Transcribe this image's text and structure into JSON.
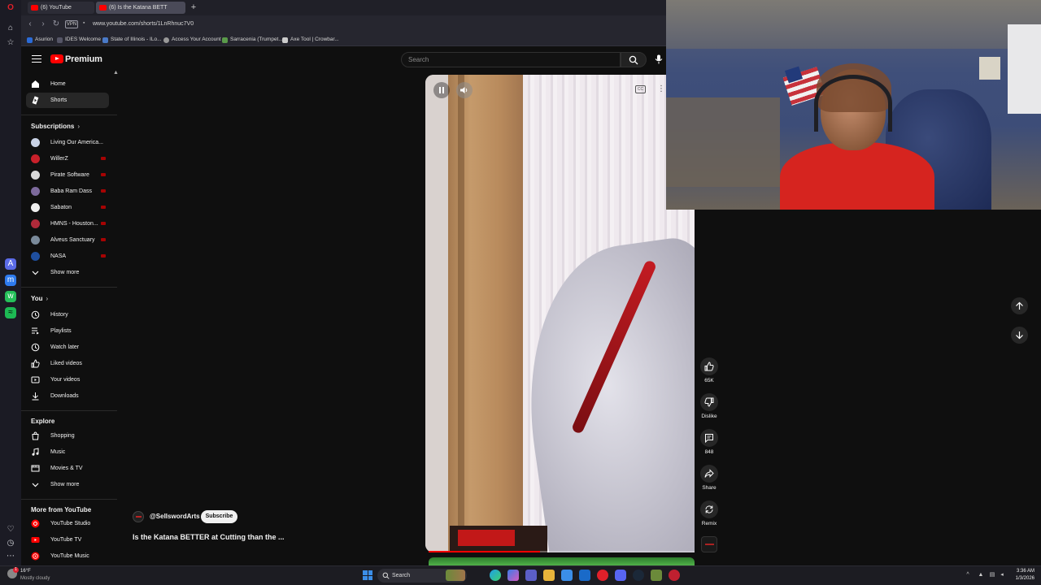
{
  "browser": {
    "tabs": [
      {
        "label": "(6) YouTube",
        "active": false
      },
      {
        "label": "(6) Is the Katana BETT",
        "active": true
      }
    ],
    "vpn_label": "VPN",
    "url": "www.youtube.com/shorts/1LnRhnuc7V0",
    "bookmarks": [
      "Asurion",
      "IDES Welcome",
      "State of Illinois - ILo...",
      "Access Your Account",
      "Sarracenia (Trumpet...",
      "Axe Tool | Crowbar..."
    ]
  },
  "masthead": {
    "brand": "Premium",
    "search_placeholder": "Search"
  },
  "guide": {
    "main": [
      {
        "label": "Home",
        "icon": "home-icon",
        "active": false
      },
      {
        "label": "Shorts",
        "icon": "shorts-icon",
        "active": true
      }
    ],
    "subscriptions_title": "Subscriptions",
    "subscriptions": [
      {
        "label": "Living Our America...",
        "color": "#c9d3e6",
        "live": false
      },
      {
        "label": "WillerZ",
        "color": "#c8202a",
        "live": true
      },
      {
        "label": "Pirate Software",
        "color": "#d9d9d9",
        "live": true
      },
      {
        "label": "Baba Ram Dass",
        "color": "#7d6a9c",
        "live": true
      },
      {
        "label": "Sabaton",
        "color": "#f0f0f0",
        "live": true
      },
      {
        "label": "HMNS - Houston...",
        "color": "#b02a3a",
        "live": true
      },
      {
        "label": "Alveus Sanctuary",
        "color": "#7a8a9a",
        "live": true
      },
      {
        "label": "NASA",
        "color": "#1f4f9e",
        "live": true
      }
    ],
    "subscriptions_more": "Show more",
    "you_title": "You",
    "you_items": [
      {
        "label": "History",
        "icon": "history-icon"
      },
      {
        "label": "Playlists",
        "icon": "playlists-icon"
      },
      {
        "label": "Watch later",
        "icon": "watch-later-icon"
      },
      {
        "label": "Liked videos",
        "icon": "liked-videos-icon"
      },
      {
        "label": "Your videos",
        "icon": "your-videos-icon"
      },
      {
        "label": "Downloads",
        "icon": "downloads-icon"
      }
    ],
    "explore_title": "Explore",
    "explore_items": [
      {
        "label": "Shopping",
        "icon": "shopping-icon"
      },
      {
        "label": "Music",
        "icon": "music-icon"
      },
      {
        "label": "Movies & TV",
        "icon": "movies-icon"
      }
    ],
    "explore_more": "Show more",
    "more_title": "More from YouTube",
    "more_items": [
      {
        "label": "YouTube Studio"
      },
      {
        "label": "YouTube TV"
      },
      {
        "label": "YouTube Music"
      }
    ]
  },
  "short": {
    "channel": "@SellswordArts",
    "subscribe_label": "Subscribe",
    "title": "Is the Katana BETTER at Cutting than the ...",
    "progress": 0.42,
    "actions": [
      {
        "key": "like",
        "label": "65K",
        "icon": "like-icon"
      },
      {
        "key": "dislike",
        "label": "Dislike",
        "icon": "dislike-icon"
      },
      {
        "key": "comments",
        "label": "848",
        "icon": "comment-icon"
      },
      {
        "key": "share",
        "label": "Share",
        "icon": "share-icon"
      },
      {
        "key": "remix",
        "label": "Remix",
        "icon": "remix-icon"
      }
    ]
  },
  "taskbar": {
    "weather_temp": "16°F",
    "weather_desc": "Mostly cloudy",
    "weather_badge": "1",
    "search_label": "Search",
    "time": "3:36 AM",
    "date": "1/3/2026"
  }
}
